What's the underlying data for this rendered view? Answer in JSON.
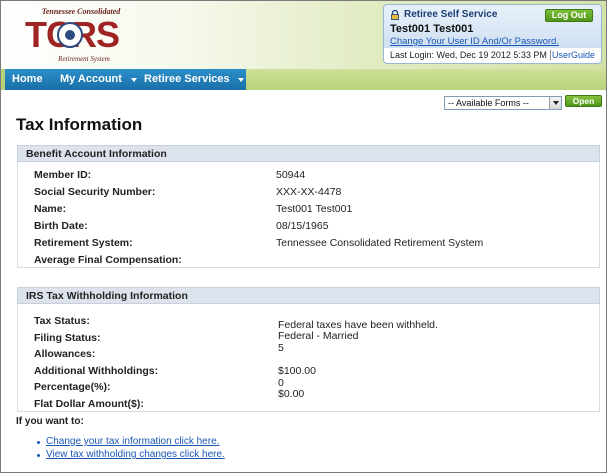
{
  "header": {
    "logo_top": "Tennessee Consolidated",
    "logo_main": "TCRS",
    "logo_bottom": "Retirement System",
    "service_title": "Retiree Self Service",
    "logout_label": "Log Out",
    "user_name": "Test001 Test001",
    "change_link": "Change Your User ID And/Or Password.",
    "last_login": "Last Login: Wed, Dec 19 2012 5:33 PM",
    "user_guide": "UserGuide"
  },
  "nav": {
    "items": [
      {
        "label": "Home"
      },
      {
        "label": "My Account"
      },
      {
        "label": "Retiree Services"
      }
    ]
  },
  "forms": {
    "selected": "-- Available Forms --",
    "open_label": "Open"
  },
  "page_title": "Tax Information",
  "benefit": {
    "heading": "Benefit Account Information",
    "rows": [
      {
        "label": "Member ID:",
        "value": "50944"
      },
      {
        "label": "Social Security Number:",
        "value": "XXX-XX-4478"
      },
      {
        "label": "Name:",
        "value": "Test001 Test001"
      },
      {
        "label": "Birth Date:",
        "value": "08/15/1965"
      },
      {
        "label": "Retirement System:",
        "value": "Tennessee Consolidated Retirement System"
      },
      {
        "label": "Average Final Compensation:",
        "value": ""
      }
    ]
  },
  "irs": {
    "heading": "IRS Tax Withholding Information",
    "labels": [
      "Tax Status:",
      "Filing Status:",
      "Allowances:",
      "Additional Withholdings:",
      "Percentage(%):",
      "Flat Dollar Amount($):"
    ],
    "values": [
      "Federal taxes have been withheld.",
      "Federal - Married",
      "5",
      "$100.00",
      "0",
      "$0.00"
    ]
  },
  "footer": {
    "prompt": "If you want to:",
    "links": [
      "Change your tax information click here.",
      "View tax withholding changes click here."
    ]
  },
  "colors": {
    "nav_blue": "#1a6fa8",
    "nav_green": "#b8d27a",
    "button_green": "#4f951b",
    "link_blue": "#1a56b3",
    "logo_red": "#9e2524"
  }
}
